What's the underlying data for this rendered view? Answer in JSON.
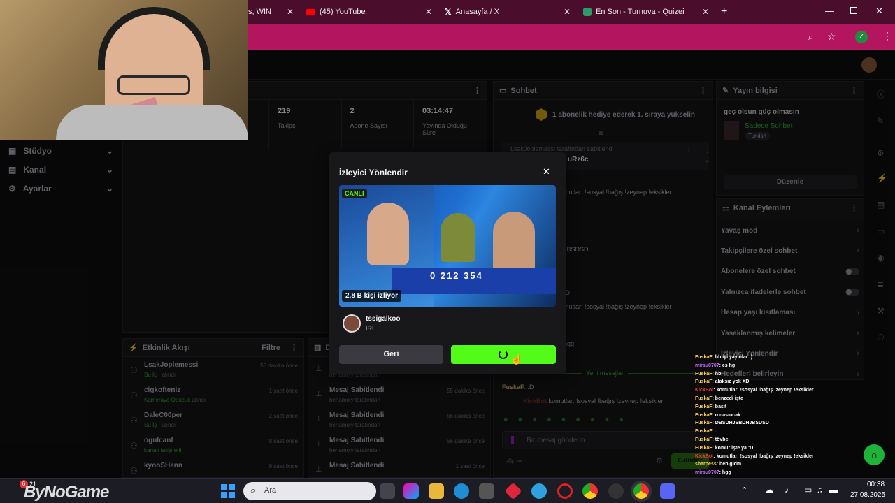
{
  "browser": {
    "tabs": [
      {
        "title": "s, WIN"
      },
      {
        "title": "(45) YouTube"
      },
      {
        "title": "Anasayfa / X"
      },
      {
        "title": "En Son - Turnuva - Quizei"
      }
    ],
    "profile_initial": "Z"
  },
  "sidebar": {
    "items": [
      {
        "label": "Stüdyo"
      },
      {
        "label": "Kanal"
      },
      {
        "label": "Ayarlar"
      }
    ]
  },
  "stats": [
    {
      "value": "219",
      "label": "Takipçi"
    },
    {
      "value": "2",
      "label": "Abone Sayısı"
    },
    {
      "value": "03:14:47",
      "label": "Yayında Olduğu Süre"
    }
  ],
  "chat": {
    "header": "Sohbet",
    "gift_banner": "1 abonelik hediye ederek 1. sıraya yükselin",
    "pinned_by": "LsakJoplemessi tarafından sabitlendi",
    "pinned_user": "uRz6c",
    "lines": [
      {
        "text": "mutlar: !sosyal !bağış !zeynep !eksikler"
      },
      {
        "text": "JBSDSD"
      },
      {
        "text": ":D"
      },
      {
        "text": "mutlar: !sosyal !bağış !zeynep !eksikler"
      },
      {
        "text": "hgg"
      }
    ],
    "new_messages": "Yeni mesajlar",
    "msg1_user": "FuskaF",
    "msg1_text": ": :D",
    "msg2_user": "KickBot",
    "msg2_text": "komutlar: !sosyal !bağış !zeynep !eksikler",
    "input_placeholder": "Bir mesaj gönderin",
    "send_label": "Gönder"
  },
  "stream_info": {
    "header": "Yayın bilgisi",
    "title": "geç olsun güç olmasın",
    "category": "Sadece Sohbet",
    "language": "Turkish",
    "edit_label": "Düzenle"
  },
  "channel_actions": {
    "header": "Kanal Eylemleri",
    "items": [
      {
        "label": "Yavaş mod"
      },
      {
        "label": "Takipçilere özel sohbet"
      },
      {
        "label": "Abonelere özel sohbet"
      },
      {
        "label": "Yalnızca ifadelerle sohbet"
      },
      {
        "label": "Hesap yaşı kısıtlaması"
      },
      {
        "label": "Yasaklanmış kelimeler"
      },
      {
        "label": "İzleyici Yönlendir"
      },
      {
        "label": "Hedefleri belirleyin"
      }
    ]
  },
  "activity": {
    "header": "Etkinlik Akışı",
    "filter_label": "Filtre",
    "items": [
      {
        "user": "LsakJoplemessi",
        "action": "Su İç",
        "suffix": "alındı",
        "time": "55 dakika önce"
      },
      {
        "user": "cigkofteniz",
        "action": "Kameraya Öpücük",
        "suffix": "alındı",
        "time": "1 saat önce"
      },
      {
        "user": "DaleC00per",
        "action": "Su İç",
        "suffix": "alındı",
        "time": "2 saat önce"
      },
      {
        "user": "ogulcanf",
        "action": "kanalı takip etti",
        "suffix": "",
        "time": "8 saat önce"
      },
      {
        "user": "kyooSHenn",
        "action": "",
        "suffix": "",
        "time": "9 saat önce"
      }
    ]
  },
  "mod_log": {
    "header": "De",
    "items": [
      {
        "title": "",
        "by": "henamoly tarafından",
        "time": ""
      },
      {
        "title": "Mesaj Sabitlendi",
        "by": "henamoly tarafından",
        "time": "55 dakika önce"
      },
      {
        "title": "Mesaj Sabitlendi",
        "by": "henamoly tarafından",
        "time": "56 dakika önce"
      },
      {
        "title": "Mesaj Sabitlendi",
        "by": "henamoly tarafından",
        "time": "56 dakika önce"
      },
      {
        "title": "Mesaj Sabitlendi",
        "by": "",
        "time": "1 saat önce"
      }
    ]
  },
  "modal": {
    "title": "İzleyici Yönlendir",
    "live_badge": "CANLI",
    "viewers": "2,8 B kişi izliyor",
    "phone_text": "0 212 354",
    "channel_name": "tssigalkoo",
    "channel_category": "IRL",
    "back_label": "Geri"
  },
  "overlay_chat": [
    {
      "user": "FuskaF",
      "text": ": hb iyi yayınlar :)",
      "style": "u"
    },
    {
      "user": "mirsu0707",
      "text": ": es hg",
      "style": "c"
    },
    {
      "user": "FuskaF",
      "text": ": hb",
      "style": "u"
    },
    {
      "user": "FuskaF",
      "text": ": alaksız yok XD",
      "style": "u"
    },
    {
      "user": "KickBot",
      "text": ": komutlar: !sosyal !bağış !zeynep !eksikler",
      "style": "k"
    },
    {
      "user": "FuskaF",
      "text": ": benzedi işte",
      "style": "u"
    },
    {
      "user": "FuskaF",
      "text": ": basit",
      "style": "u"
    },
    {
      "user": "FuskaF",
      "text": ": o nasıucak",
      "style": "u"
    },
    {
      "user": "FuskaF",
      "text": ": DBSDHJSBDHJBSDSD",
      "style": "u"
    },
    {
      "user": "FuskaF",
      "text": ": ..",
      "style": "u"
    },
    {
      "user": "FuskaF",
      "text": ": tövbe",
      "style": "u"
    },
    {
      "user": "FuskaF",
      "text": ": kömür işte ya :D",
      "style": "u"
    },
    {
      "user": "KickBot",
      "text": ": komutlar: !sosyal !bağış !zeynep !eksikler",
      "style": "k"
    },
    {
      "user": "sharpess",
      "text": ": ben gldm",
      "style": "u"
    },
    {
      "user": "mirsu0707",
      "text": ": hgg",
      "style": "c"
    },
    {
      "user": "sharpess",
      "text": ": hbbb",
      "style": "u"
    },
    {
      "user": "FuskaF",
      "text": ": :D",
      "style": "u"
    },
    {
      "user": "KickBot",
      "text": ": komutlar: !sosyal !bağış !zeynep !eksikler",
      "style": "k"
    }
  ],
  "taskbar": {
    "search_placeholder": "Ara",
    "weather_temp": "21",
    "time": "00:38",
    "date": "27.08.2025",
    "watermark": "ByNoGame"
  },
  "colors": {
    "kick_green": "#53fc18",
    "browser_accent": "#b3155f",
    "tab_bg": "#4a0d2c"
  }
}
